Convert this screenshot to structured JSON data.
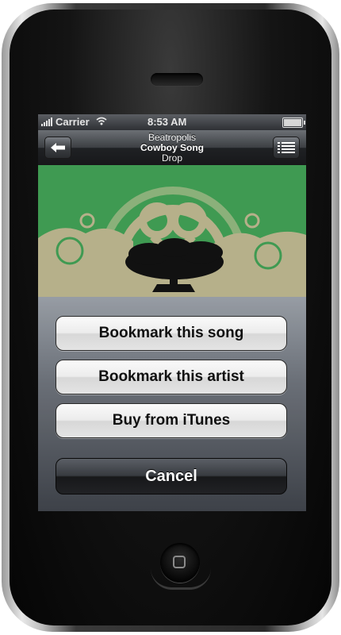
{
  "status_bar": {
    "carrier": "Carrier",
    "time": "8:53 AM",
    "signal_icon": "signal-bars-icon",
    "wifi_icon": "wifi-icon",
    "battery_icon": "battery-icon"
  },
  "nav": {
    "artist": "Beatropolis",
    "song": "Cowboy Song",
    "album": "Drop",
    "back_icon": "back-arrow-icon",
    "list_icon": "track-list-icon"
  },
  "action_sheet": {
    "buttons": [
      {
        "label": "Bookmark this song"
      },
      {
        "label": "Bookmark this artist"
      },
      {
        "label": "Buy from iTunes"
      }
    ],
    "cancel_label": "Cancel"
  },
  "colors": {
    "artwork_green": "#3f9a52",
    "artwork_tan": "#b6b08a",
    "navbar_dark": "#1f2124"
  }
}
